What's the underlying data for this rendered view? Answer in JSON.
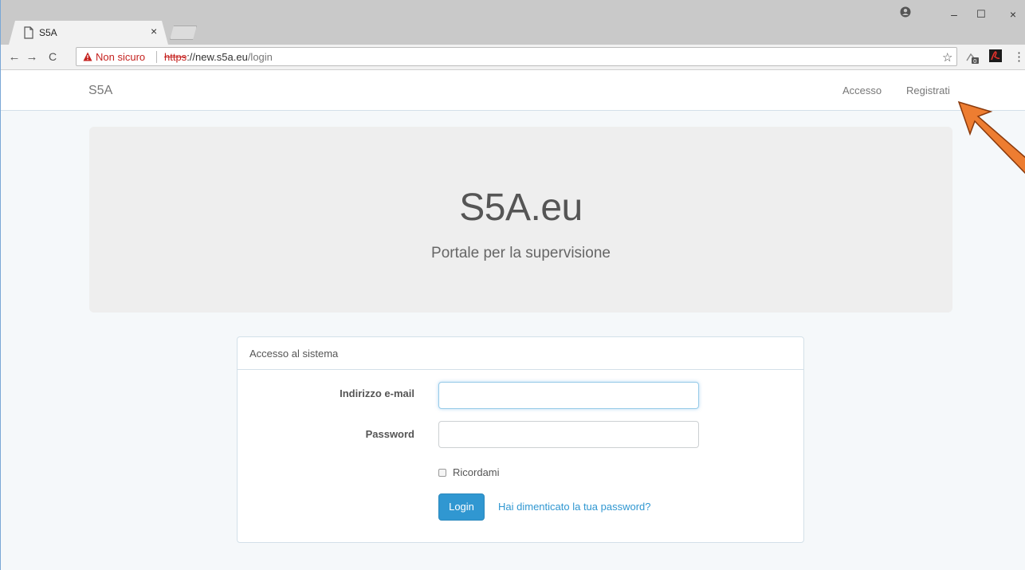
{
  "browser": {
    "tab_title": "S5A",
    "tab_close": "×",
    "security_text": "Non sicuro",
    "url_scheme": "https",
    "url_host": "://new.s5a.eu",
    "url_path": "/login",
    "nav_back": "←",
    "nav_forward": "→",
    "nav_reload": "C",
    "win_minimize": "–",
    "win_maximize": "☐",
    "win_close": "×",
    "star": "☆",
    "menu": "⋮"
  },
  "navbar": {
    "brand": "S5A",
    "links": [
      "Accesso",
      "Registrati"
    ]
  },
  "jumbotron": {
    "title": "S5A.eu",
    "subtitle": "Portale per la supervisione"
  },
  "login_panel": {
    "heading": "Accesso al sistema",
    "email_label": "Indirizzo e-mail",
    "email_value": "",
    "password_label": "Password",
    "password_value": "",
    "remember_label": "Ricordami",
    "remember_checked": false,
    "login_button": "Login",
    "forgot_link": "Hai dimenticato la tua password?"
  },
  "colors": {
    "accent": "#3097d1",
    "annotation_arrow": "#ed7d31"
  }
}
